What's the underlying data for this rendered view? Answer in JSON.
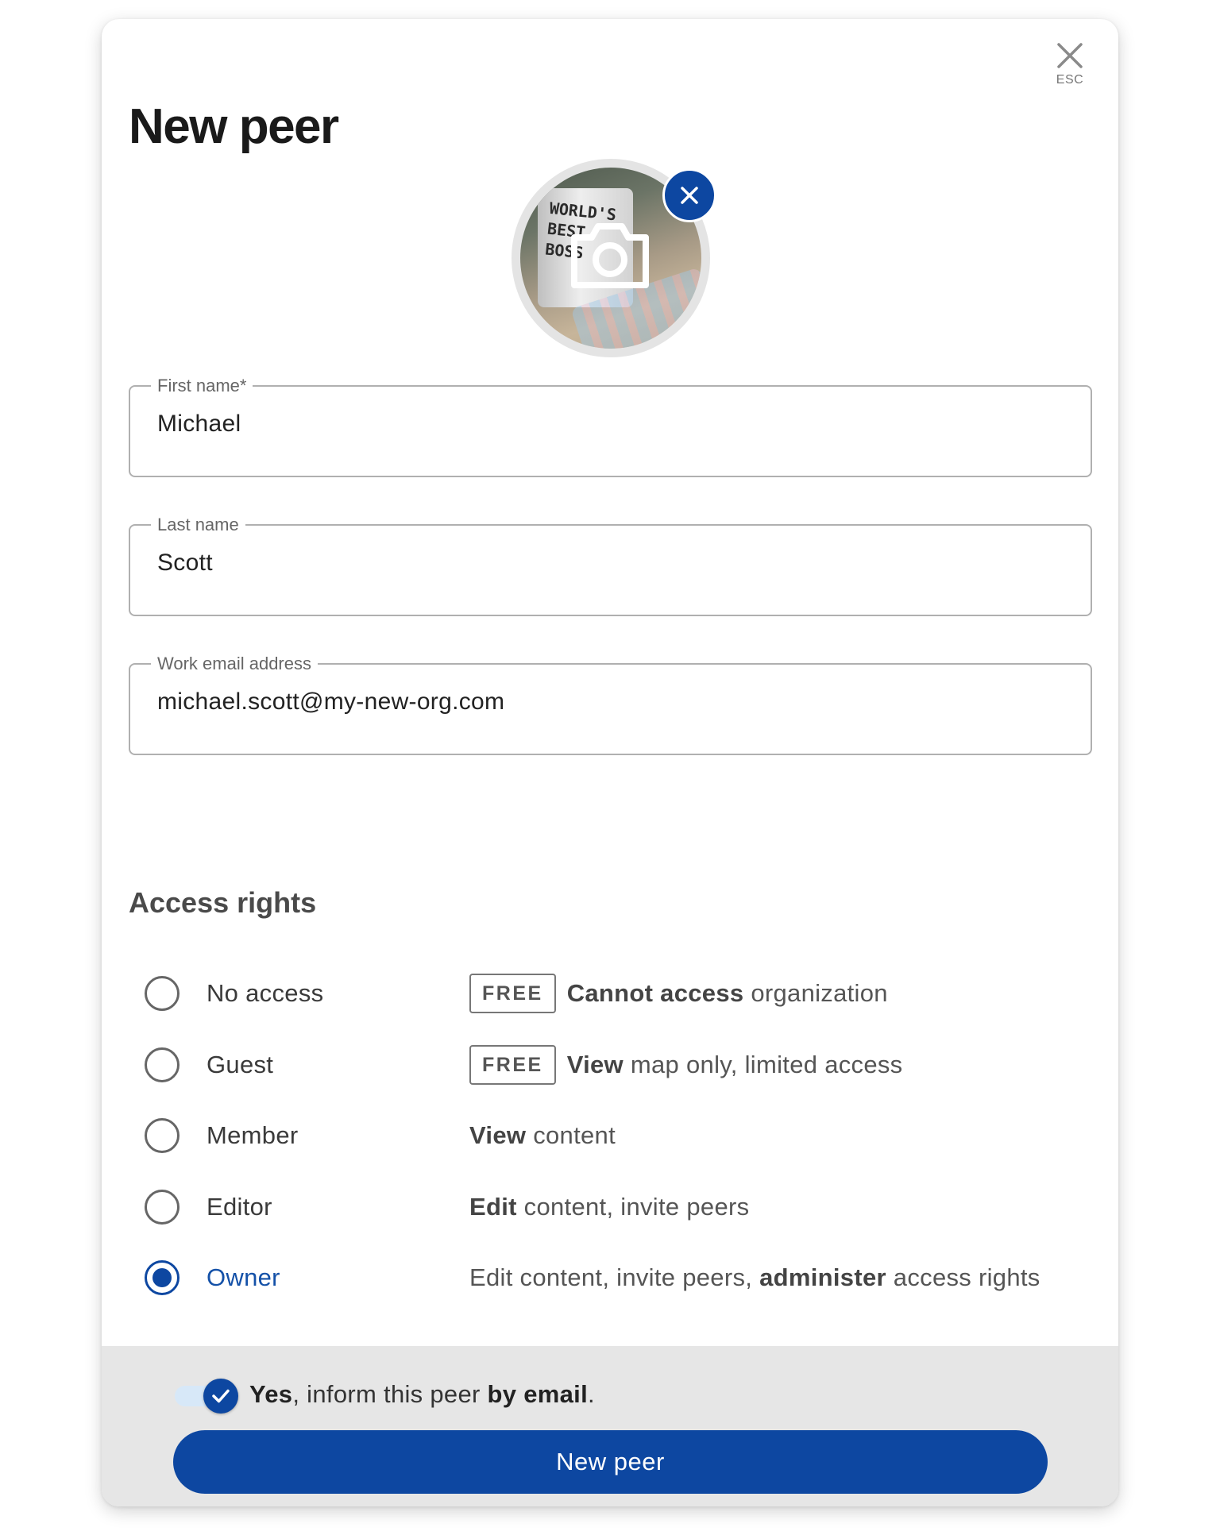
{
  "dialog": {
    "title": "New peer",
    "close_label": "ESC"
  },
  "avatar": {
    "photo_mug_text": [
      "WORLD'S",
      "BEST",
      "BOSS"
    ],
    "remove_icon": "close-icon",
    "camera_icon": "camera-icon"
  },
  "form": {
    "first_name": {
      "label": "First name*",
      "value": "Michael"
    },
    "last_name": {
      "label": "Last name",
      "value": "Scott"
    },
    "email": {
      "label": "Work email address",
      "value": "michael.scott@my-new-org.com"
    }
  },
  "access": {
    "title": "Access rights",
    "selected": "Owner",
    "options": [
      {
        "label": "No access",
        "badge": "FREE",
        "desc_bold": "Cannot access",
        "desc_rest": " organization"
      },
      {
        "label": "Guest",
        "badge": "FREE",
        "desc_bold": "View",
        "desc_rest": " map only, limited access"
      },
      {
        "label": "Member",
        "badge": "",
        "desc_bold": "View",
        "desc_rest": " content"
      },
      {
        "label": "Editor",
        "badge": "",
        "desc_bold": "Edit",
        "desc_rest": " content, invite peers"
      },
      {
        "label": "Owner",
        "badge": "",
        "desc_pre": "Edit content, invite peers, ",
        "desc_bold": "administer",
        "desc_rest": " access rights"
      }
    ]
  },
  "footer": {
    "notify_yes": "Yes",
    "notify_mid": ", inform this peer ",
    "notify_bold": "by email",
    "notify_end": ".",
    "notify_checked": true,
    "submit_label": "New peer"
  },
  "colors": {
    "primary": "#0d47a1",
    "selected_text": "#1451a8",
    "footer_bg": "#e6e6e6"
  }
}
